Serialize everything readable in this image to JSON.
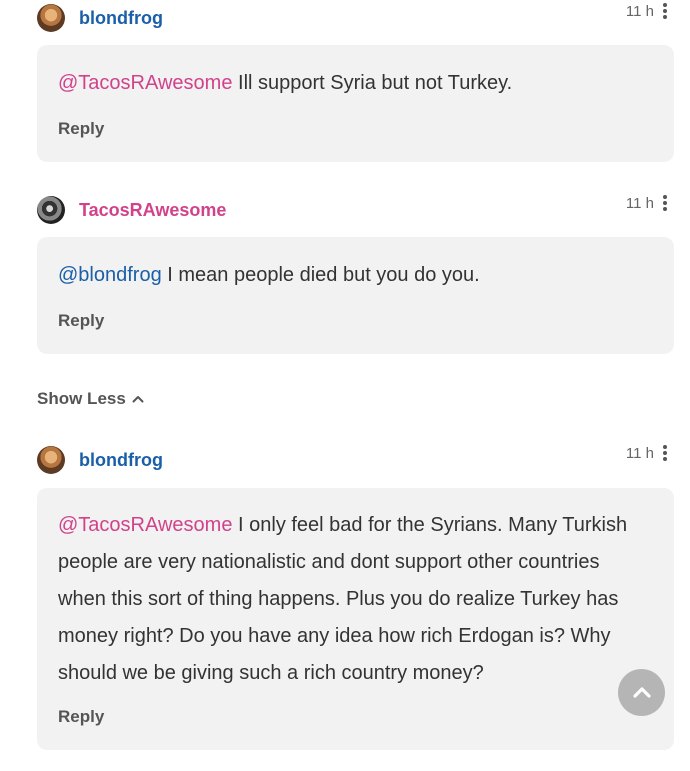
{
  "comments": [
    {
      "username": "blondfrog",
      "time": "11 h",
      "mention": "@TacosRAwesome",
      "text": " Ill support Syria but not Turkey.",
      "reply_label": "Reply"
    },
    {
      "username": "TacosRAwesome",
      "time": "11 h",
      "mention": "@blondfrog",
      "text": " I mean people died but you do you.",
      "reply_label": "Reply"
    },
    {
      "username": "blondfrog",
      "time": "11 h",
      "mention": "@TacosRAwesome",
      "text": " I only feel bad for the Syrians. Many Turkish people are very nationalistic and dont support other countries when this sort of thing happens. Plus you do realize Turkey has money right? Do you have any idea how rich Erdogan is? Why should we be giving such a rich country money?",
      "reply_label": "Reply"
    }
  ],
  "show_less_label": "Show Less",
  "icons": {
    "menu": "vertical-dots-icon",
    "show_less": "chevron-up-icon",
    "scroll_top": "chevron-up-icon"
  },
  "colors": {
    "username_blue": "#1a5fa8",
    "username_pink": "#d2428b",
    "bubble_bg": "#f2f2f3"
  }
}
